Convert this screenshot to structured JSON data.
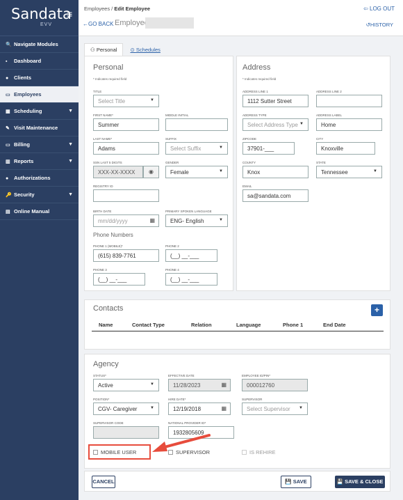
{
  "app": {
    "logo": "Sandata",
    "logo_sub": "EVV"
  },
  "sidebar": {
    "items": [
      {
        "icon": "🔍",
        "label": "Navigate Modules"
      },
      {
        "icon": "▪",
        "label": "Dashboard"
      },
      {
        "icon": "●",
        "label": "Clients"
      },
      {
        "icon": "▭",
        "label": "Employees"
      },
      {
        "icon": "▦",
        "label": "Scheduling",
        "caret": "▼"
      },
      {
        "icon": "✎",
        "label": "Visit Maintenance"
      },
      {
        "icon": "▭",
        "label": "Billing",
        "caret": "▼"
      },
      {
        "icon": "▥",
        "label": "Reports",
        "caret": "▼"
      },
      {
        "icon": "●",
        "label": "Authorizations"
      },
      {
        "icon": "🔑",
        "label": "Security",
        "caret": "▼"
      },
      {
        "icon": "▤",
        "label": "Online Manual"
      }
    ]
  },
  "header": {
    "bread_parent": "Employees / ",
    "bread_current": "Edit Employee",
    "goback": "←GO BACK",
    "employee_label": "Employee:",
    "logout": "⇦ LOG OUT",
    "history": "↺HISTORY"
  },
  "tabs": {
    "personal": "Personal",
    "schedules": "Schedules"
  },
  "personal": {
    "title": "Personal",
    "req": "* Indicates required field",
    "title_lbl": "TITLE",
    "title_val": "Select Title",
    "first_lbl": "FIRST NAME*",
    "first_val": "Summer",
    "middle_lbl": "MIDDLE INITIAL",
    "middle_val": "",
    "last_lbl": "LAST NAME*",
    "last_val": "Adams",
    "suffix_lbl": "SUFFIX",
    "suffix_val": "Select Suffix",
    "ssn_lbl": "SSN LAST 5 DIGITS",
    "ssn_val": "XXX-XX-XXXX",
    "gender_lbl": "GENDER",
    "gender_val": "Female",
    "registry_lbl": "REGISTRY ID",
    "registry_val": "",
    "birth_lbl": "BIRTH DATE",
    "birth_ph": "mm/dd/yyyy",
    "lang_lbl": "PRIMARY SPOKEN LANGUAGE",
    "lang_val": "ENG- English",
    "phones_title": "Phone Numbers",
    "p1_lbl": "PHONE 1 (MOBILE)*",
    "p1_val": "(615) 839-7761",
    "p2_lbl": "PHONE 2",
    "p2_val": "(__) __-___",
    "p3_lbl": "PHONE 3",
    "p3_val": "(__) __-___",
    "p4_lbl": "PHONE 4",
    "p4_val": "(__) __-___"
  },
  "address": {
    "title": "Address",
    "req": "* Indicates required field",
    "a1_lbl": "ADDRESS LINE 1",
    "a1_val": "1112 Sutter Street",
    "a2_lbl": "ADDRESS LINE 2",
    "a2_val": "",
    "type_lbl": "ADDRESS TYPE",
    "type_val": "Select Address Type",
    "label_lbl": "ADDRESS LABEL",
    "label_val": "Home",
    "zip_lbl": "ZIPCODE",
    "zip_val": "37901-___",
    "city_lbl": "CITY",
    "city_val": "Knoxville",
    "county_lbl": "COUNTY",
    "county_val": "Knox",
    "state_lbl": "STATE",
    "state_val": "Tennessee",
    "email_lbl": "EMAIL",
    "email_val": "sa@sandata.com"
  },
  "contacts": {
    "title": "Contacts",
    "plus": "+",
    "columns": [
      "Name",
      "Contact Type",
      "Relation",
      "Language",
      "Phone 1",
      "End Date"
    ]
  },
  "agency": {
    "title": "Agency",
    "status_lbl": "STATUS*",
    "status_val": "Active",
    "eff_lbl": "EFFECTIVE DATE",
    "eff_val": "11/28/2023",
    "empid_lbl": "EMPLOYEE ID/PIN*",
    "empid_val": "000012760",
    "pos_lbl": "POSITION*",
    "pos_val": "CGV- Caregiver",
    "hire_lbl": "HIRE DATE*",
    "hire_val": "12/19/2018",
    "sup_lbl": "SUPERVISOR",
    "sup_val": "Select Supervisor",
    "supcode_lbl": "SUPERVISOR CODE",
    "supcode_val": "",
    "npi_lbl": "NATIONAL PROVIDER ID*",
    "npi_val": "1932805609",
    "mobile": "MOBILE USER",
    "supervisor": "SUPERVISOR",
    "rehire": "IS REHIRE"
  },
  "actions": {
    "cancel": "CANCEL",
    "save": "💾 SAVE",
    "save_close": "💾 SAVE & CLOSE"
  },
  "colors": {
    "sidebar": "#2b3f62",
    "link": "#2b61a8",
    "highlight": "#e74c3c"
  }
}
